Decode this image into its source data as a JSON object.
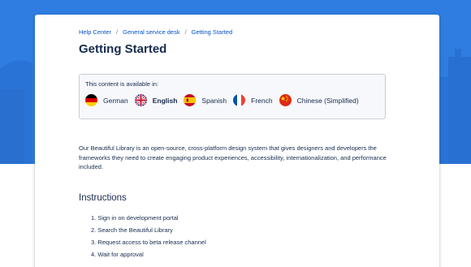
{
  "colors": {
    "hero_background": "#2f7de1",
    "link": "#0052cc",
    "text": "#172b4d"
  },
  "breadcrumb": {
    "items": [
      "Help Center",
      "General service desk",
      "Getting Started"
    ],
    "separator": "/"
  },
  "page": {
    "title": "Getting Started"
  },
  "languages": {
    "intro": "This content is available in:",
    "items": [
      {
        "label": "German",
        "icon": "germany-flag-icon",
        "active": false
      },
      {
        "label": "English",
        "icon": "uk-flag-icon",
        "active": true
      },
      {
        "label": "Spanish",
        "icon": "spain-flag-icon",
        "active": false
      },
      {
        "label": "French",
        "icon": "france-flag-icon",
        "active": false
      },
      {
        "label": "Chinese (Simplified)",
        "icon": "china-flag-icon",
        "active": false
      }
    ]
  },
  "content": {
    "description": "Our Beautiful Library is an open-source, cross-platform design system that gives designers and developers the frameworks they need to create engaging product experiences, accessibility, internationalization, and performance included.",
    "instructions_heading": "Instructions",
    "instructions": [
      "1. Sign in on development portal",
      "2. Search the Beautiful Library",
      "3. Request access to beta release channel",
      "4. Wait for approval"
    ]
  }
}
